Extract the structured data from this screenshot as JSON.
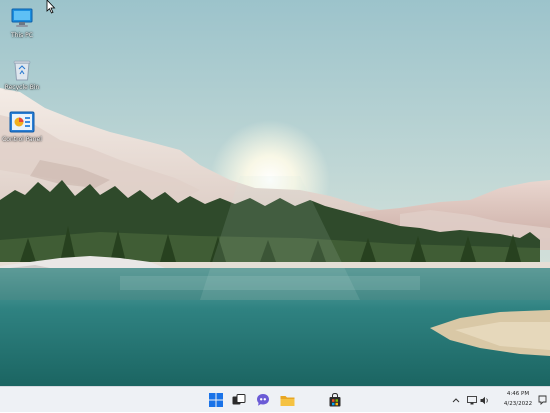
{
  "desktop": {
    "icons": [
      {
        "label": "This PC",
        "icon": "this-pc-icon"
      },
      {
        "label": "Recycle Bin",
        "icon": "recycle-bin-icon"
      },
      {
        "label": "Control Panel",
        "icon": "control-panel-icon"
      }
    ],
    "wallpaper": "mountain-lake-landscape"
  },
  "taskbar": {
    "apps": [
      "start-icon",
      "task-view-icon",
      "chat-icon",
      "file-explorer-icon",
      "store-icon"
    ],
    "tray": {
      "overflow_icon": "chevron-up-icon",
      "network_icon": "network-icon",
      "volume_icon": "volume-icon",
      "notification_icon": "notification-icon"
    },
    "clock": {
      "time": "4:46 PM",
      "date": "4/23/2022"
    }
  },
  "colors": {
    "taskbar_bg": "#eef1f5",
    "start_blue": "#1a73e8",
    "explorer_yellow": "#f5c242"
  }
}
